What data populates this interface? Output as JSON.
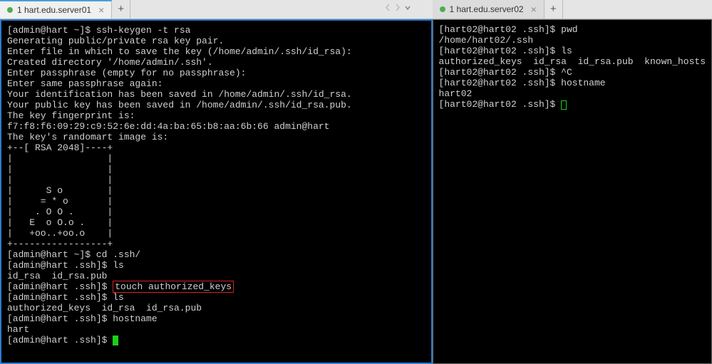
{
  "left": {
    "tab_label": "1 hart.edu.server01",
    "lines": [
      {
        "t": "[admin@hart ~]$ ssh-keygen -t rsa"
      },
      {
        "t": "Generating public/private rsa key pair."
      },
      {
        "t": "Enter file in which to save the key (/home/admin/.ssh/id_rsa):"
      },
      {
        "t": "Created directory '/home/admin/.ssh'."
      },
      {
        "t": "Enter passphrase (empty for no passphrase):"
      },
      {
        "t": "Enter same passphrase again:"
      },
      {
        "t": "Your identification has been saved in /home/admin/.ssh/id_rsa."
      },
      {
        "t": "Your public key has been saved in /home/admin/.ssh/id_rsa.pub."
      },
      {
        "t": "The key fingerprint is:"
      },
      {
        "t": "f7:f8:f6:09:29:c9:52:6e:dd:4a:ba:65:b8:aa:6b:66 admin@hart"
      },
      {
        "t": "The key's randomart image is:"
      },
      {
        "t": "+--[ RSA 2048]----+"
      },
      {
        "t": "|                 |"
      },
      {
        "t": "|                 |"
      },
      {
        "t": "|                 |"
      },
      {
        "t": "|      S o        |"
      },
      {
        "t": "|     = * o       |"
      },
      {
        "t": "|    . O O .      |"
      },
      {
        "t": "|   E  o O.o .    |"
      },
      {
        "t": "|   +oo..+oo.o    |"
      },
      {
        "t": "+-----------------+"
      },
      {
        "t": "[admin@hart ~]$ cd .ssh/"
      },
      {
        "t": "[admin@hart .ssh]$ ls"
      },
      {
        "t": "id_rsa  id_rsa.pub"
      },
      {
        "prefix": "[admin@hart .ssh]$ ",
        "hl": "touch authorized_keys"
      },
      {
        "t": "[admin@hart .ssh]$ ls"
      },
      {
        "t": "authorized_keys  id_rsa  id_rsa.pub"
      },
      {
        "t": "[admin@hart .ssh]$ hostname"
      },
      {
        "t": "hart"
      },
      {
        "prefix": "[admin@hart .ssh]$ ",
        "cursor": "block"
      }
    ]
  },
  "right": {
    "tab_label": "1 hart.edu.server02",
    "lines": [
      {
        "t": "[hart02@hart02 .ssh]$ pwd"
      },
      {
        "t": "/home/hart02/.ssh"
      },
      {
        "t": "[hart02@hart02 .ssh]$ ls"
      },
      {
        "t": "authorized_keys  id_rsa  id_rsa.pub  known_hosts"
      },
      {
        "t": "[hart02@hart02 .ssh]$ ^C"
      },
      {
        "t": "[hart02@hart02 .ssh]$ hostname"
      },
      {
        "t": "hart02"
      },
      {
        "prefix": "[hart02@hart02 .ssh]$ ",
        "cursor": "outline"
      }
    ]
  }
}
